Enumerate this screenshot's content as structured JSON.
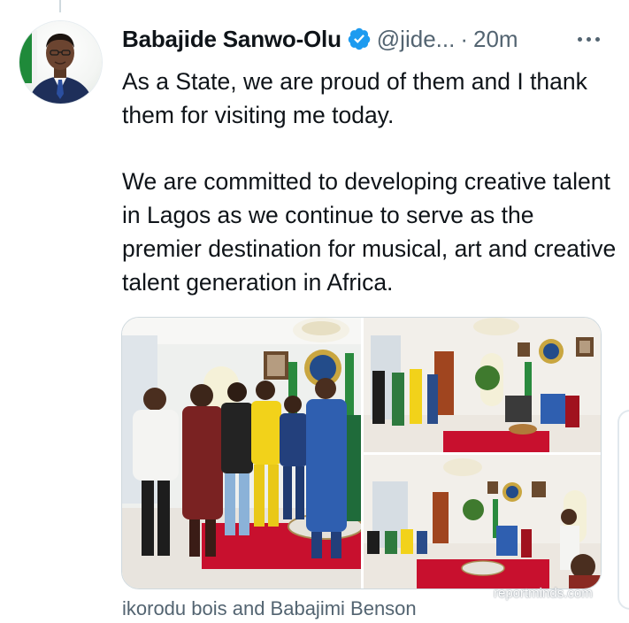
{
  "tweet": {
    "author_name": "Babajide Sanwo-Olu",
    "handle": "@jide...",
    "separator": "·",
    "time": "20m",
    "verified": true,
    "paragraphs": [
      "As a State, we are proud of them and I thank them for visiting me today.",
      "We are committed to developing creative talent in Lagos as we continue to serve as the premier destination for musical, art and creative talent generation in Africa."
    ]
  },
  "icons": {
    "verified": "verified-badge-icon",
    "more": "more-options-icon"
  },
  "media": {
    "photo_count": 3
  },
  "caption": "ikorodu bois and Babajimi Benson",
  "watermark": "reportminds.com",
  "colors": {
    "verified_blue": "#1d9bf0",
    "secondary_text": "#536471",
    "primary_text": "#0f1419",
    "carpet_red": "#c8102e"
  }
}
